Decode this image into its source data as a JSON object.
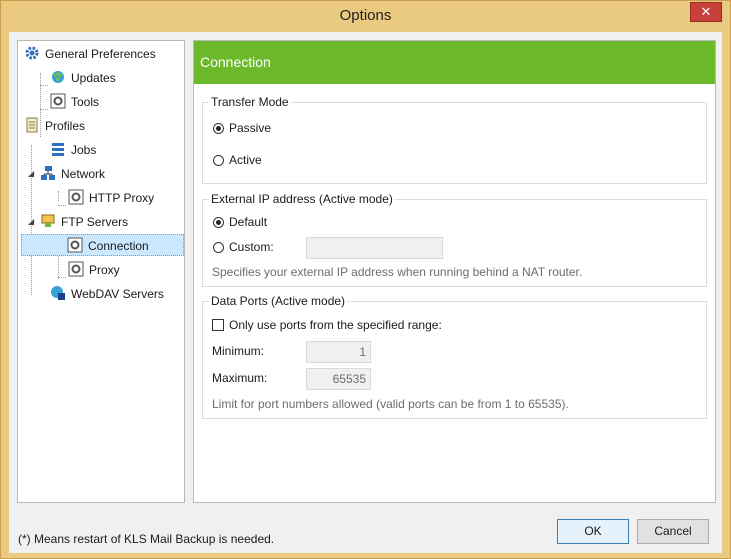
{
  "window": {
    "title": "Options",
    "close_glyph": "✕"
  },
  "tree": {
    "items": [
      {
        "label": "General Preferences",
        "icon": "gear-icon"
      },
      {
        "label": "Updates",
        "icon": "globe-refresh-icon"
      },
      {
        "label": "Tools",
        "icon": "tools-icon"
      },
      {
        "label": "Profiles",
        "icon": "profiles-icon"
      },
      {
        "label": "Jobs",
        "icon": "jobs-icon"
      },
      {
        "label": "Network",
        "icon": "network-icon"
      },
      {
        "label": "HTTP Proxy",
        "icon": "proxy-icon"
      },
      {
        "label": "FTP Servers",
        "icon": "ftp-servers-icon"
      },
      {
        "label": "Connection",
        "icon": "connection-icon"
      },
      {
        "label": "Proxy",
        "icon": "proxy-icon"
      },
      {
        "label": "WebDAV Servers",
        "icon": "webdav-icon"
      }
    ],
    "selected": "Connection"
  },
  "panel": {
    "title": "Connection",
    "header_color": "#6cb92c",
    "transfer_mode": {
      "legend": "Transfer Mode",
      "options": [
        {
          "label": "Passive",
          "checked": true
        },
        {
          "label": "Active",
          "checked": false
        }
      ]
    },
    "external_ip": {
      "legend": "External IP address (Active mode)",
      "default_label": "Default",
      "custom_label": "Custom:",
      "custom_value": "",
      "hint": "Specifies your external IP address when running behind a NAT router."
    },
    "data_ports": {
      "legend": "Data Ports (Active mode)",
      "checkbox_label": "Only use ports from the specified range:",
      "checkbox_checked": false,
      "minimum_label": "Minimum:",
      "minimum_value": "1",
      "maximum_label": "Maximum:",
      "maximum_value": "65535",
      "hint": "Limit for port numbers allowed (valid ports can be from 1 to 65535)."
    }
  },
  "footer": {
    "note": "(*) Means restart of KLS Mail Backup is needed.",
    "ok_label": "OK",
    "cancel_label": "Cancel"
  }
}
